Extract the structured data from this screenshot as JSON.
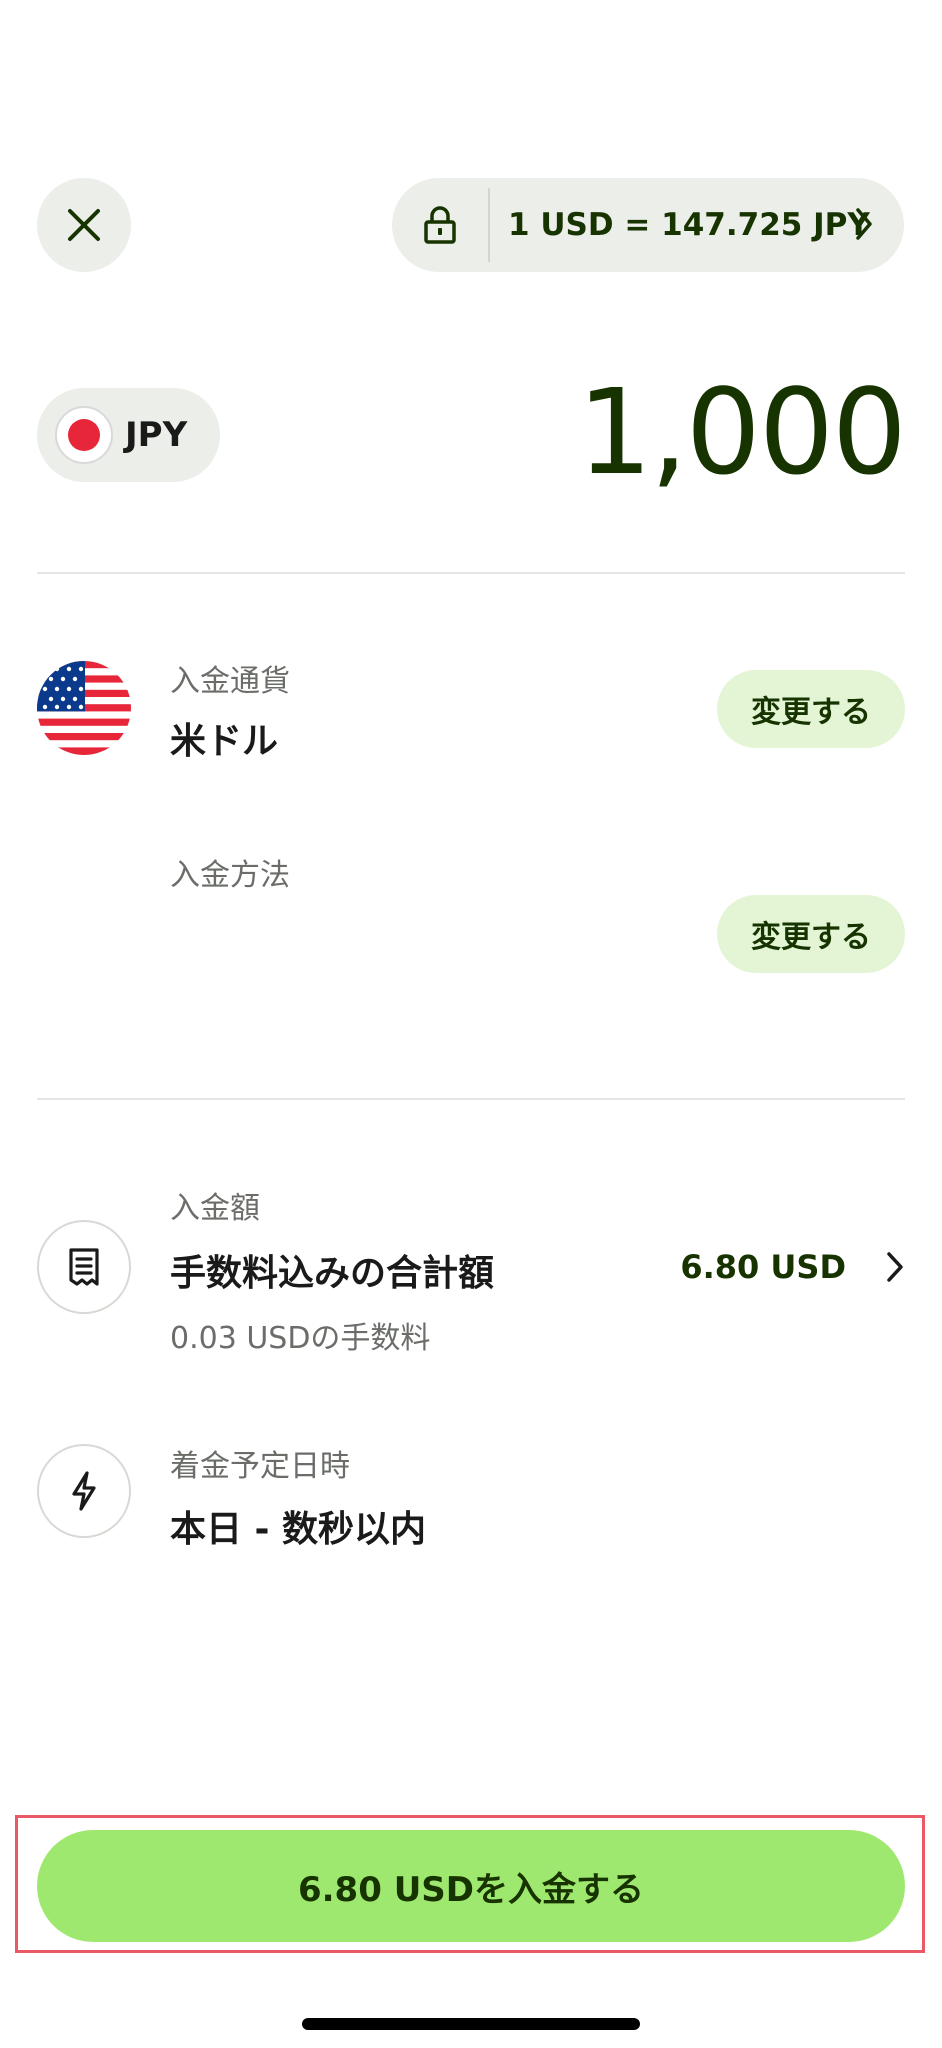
{
  "header": {
    "exchange_rate": "1 USD = 147.725 JPY"
  },
  "source": {
    "currency_code": "JPY",
    "amount": "1,000"
  },
  "deposit_currency": {
    "label": "入金通貨",
    "value": "米ドル",
    "change_label": "変更する"
  },
  "deposit_method": {
    "label": "入金方法",
    "change_label": "変更する"
  },
  "deposit_amount": {
    "label": "入金額",
    "title": "手数料込みの合計額",
    "value": "6.80 USD",
    "fee_note": "0.03 USDの手数料"
  },
  "arrival": {
    "label": "着金予定日時",
    "value": "本日 - 数秒以内"
  },
  "cta": {
    "label": "6.80 USDを入金する"
  },
  "colors": {
    "brand_green": "#9fe870",
    "dark_green": "#163300",
    "light_green": "#e3f5d5",
    "pill_gray": "#eceee9",
    "highlight_red": "#ea5a66"
  },
  "icons": [
    "close-icon",
    "lock-icon",
    "chevron-right-icon",
    "japan-flag-icon",
    "us-flag-icon",
    "receipt-icon",
    "lightning-icon"
  ]
}
